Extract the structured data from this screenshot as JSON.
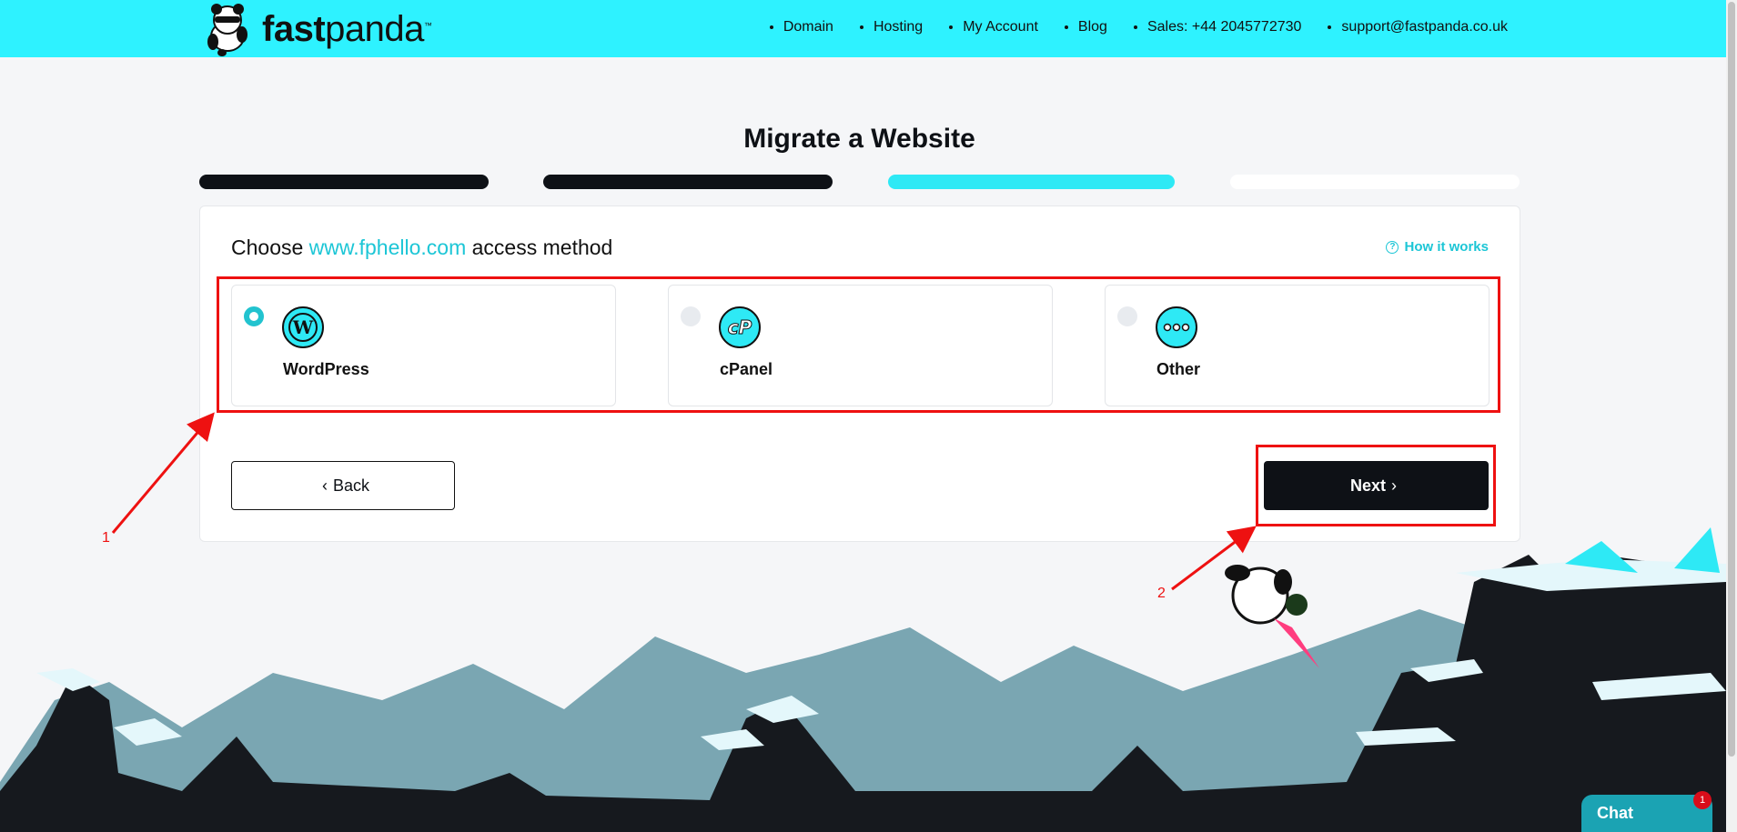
{
  "brand": {
    "name_bold": "fast",
    "name_rest": "panda",
    "tm": "™"
  },
  "nav": [
    {
      "label": "Domain"
    },
    {
      "label": "Hosting"
    },
    {
      "label": "My Account"
    },
    {
      "label": "Blog"
    },
    {
      "label": "Sales: +44 2045772730"
    },
    {
      "label": "support@fastpanda.co.uk"
    }
  ],
  "page": {
    "title": "Migrate a Website"
  },
  "steps": {
    "total": 4,
    "current": 3,
    "colors": {
      "done": "#0e1116",
      "active": "#2ee9f5",
      "todo": "#ffffff"
    }
  },
  "card": {
    "choose_prefix": "Choose",
    "domain": "www.fphello.com",
    "choose_suffix": "access method",
    "how_it_works": "How it works",
    "options": [
      {
        "label": "WordPress",
        "icon": "wordpress-icon",
        "selected": true
      },
      {
        "label": "cPanel",
        "icon": "cpanel-icon",
        "selected": false
      },
      {
        "label": "Other",
        "icon": "more-dots-icon",
        "selected": false
      }
    ],
    "back_label": "Back",
    "next_label": "Next"
  },
  "annotations": {
    "label_1": "1",
    "label_2": "2"
  },
  "chat": {
    "label": "Chat",
    "badge": "1"
  },
  "colors": {
    "accent": "#2ef2ff",
    "link": "#1cc6d6",
    "dark": "#0e1116",
    "annotation": "#ee1111"
  }
}
